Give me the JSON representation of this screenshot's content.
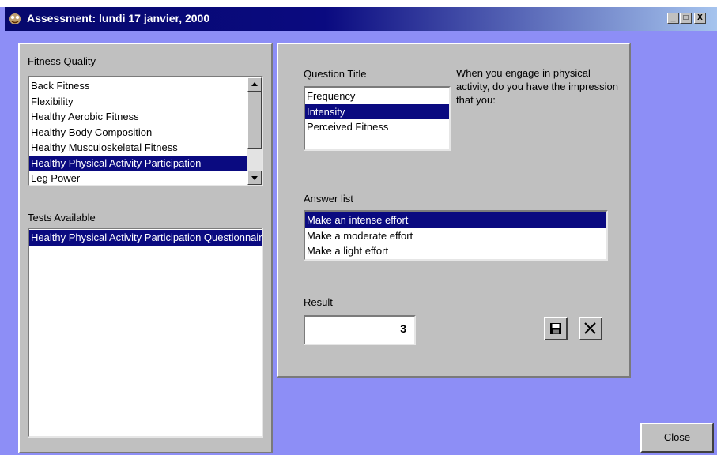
{
  "window": {
    "title": "Assessment: lundi 17 janvier, 2000",
    "controls": {
      "minimize": "_",
      "maximize": "□",
      "close": "X"
    }
  },
  "fitness_quality": {
    "label": "Fitness Quality",
    "items": [
      "Back Fitness",
      "Flexibility",
      "Healthy Aerobic Fitness",
      "Healthy Body Composition",
      "Healthy Musculoskeletal Fitness",
      "Healthy Physical Activity Participation",
      "Leg Power"
    ],
    "selected_index": 5
  },
  "tests_available": {
    "label": "Tests Available",
    "items": [
      "Healthy Physical Activity Participation Questionnaire"
    ],
    "selected_index": 0
  },
  "question": {
    "title_label": "Question Title",
    "titles": [
      "Frequency",
      "Intensity",
      "Perceived Fitness"
    ],
    "selected_index": 1,
    "text": "When you engage in physical activity, do you have the impression that you:"
  },
  "answers": {
    "label": "Answer list",
    "items": [
      "Make an intense effort",
      "Make a moderate effort",
      "Make a light effort"
    ],
    "selected_index": 0
  },
  "result": {
    "label": "Result",
    "value": "3"
  },
  "icons": {
    "save": "save-icon",
    "cancel": "cancel-icon"
  },
  "footer": {
    "close_label": "Close"
  },
  "colors": {
    "background": "#8d8ef6",
    "panel": "#c0c0c0",
    "selection": "#0a0a80"
  }
}
